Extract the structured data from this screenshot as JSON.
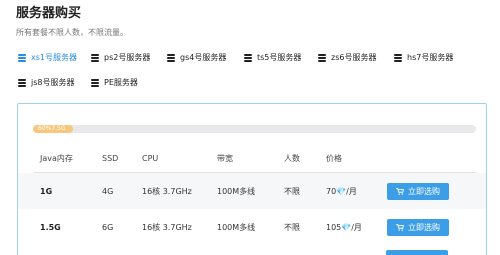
{
  "page": {
    "title": "服务器购买",
    "subtitle": "所有套餐不限人数，不限流量。"
  },
  "tabs": [
    {
      "label": "xs1号服务器",
      "active": true
    },
    {
      "label": "ps2号服务器",
      "active": false
    },
    {
      "label": "gs4号服务器",
      "active": false
    },
    {
      "label": "ts5号服务器",
      "active": false
    },
    {
      "label": "zs6号服务器",
      "active": false
    },
    {
      "label": "hs7号服务器",
      "active": false
    },
    {
      "label": "js8号服务器",
      "active": false
    },
    {
      "label": "PE服务器",
      "active": false
    }
  ],
  "stock": {
    "text": "60%7.5G",
    "fraction": 0.09
  },
  "table": {
    "headers": [
      "Java内存",
      "SSD",
      "CPU",
      "带宽",
      "人数",
      "价格"
    ],
    "rows": [
      {
        "mem": "1G",
        "ssd": "4G",
        "cpu": "16核 3.7GHz",
        "bandwidth": "100M多线",
        "players": "不限",
        "price": "70💎/月",
        "button": "立即选购"
      },
      {
        "mem": "1.5G",
        "ssd": "6G",
        "cpu": "16核 3.7GHz",
        "bandwidth": "100M多线",
        "players": "不限",
        "price": "105💎/月",
        "button": "立即选购"
      }
    ]
  },
  "colors": {
    "accent": "#3d9ee8",
    "active_tab": "#2b8cdf",
    "progress_fill": "#f6c77c",
    "panel_border": "#9fd1f5"
  }
}
